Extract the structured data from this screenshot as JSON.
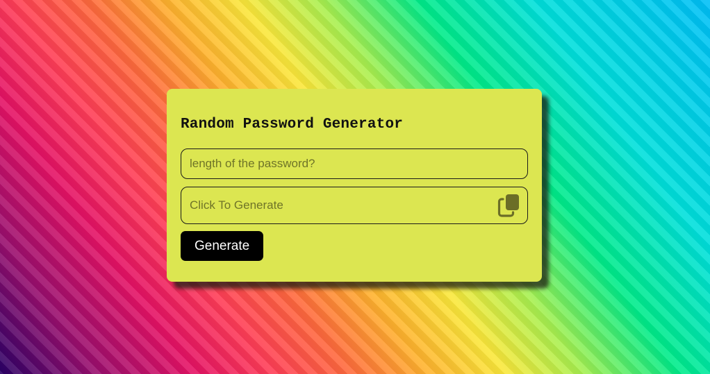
{
  "app": {
    "title": "Random Password Generator"
  },
  "length_input": {
    "placeholder": "length of the password?",
    "value": ""
  },
  "output_input": {
    "placeholder": "Click To Generate",
    "value": ""
  },
  "icons": {
    "copy": "copy-icon"
  },
  "buttons": {
    "generate_label": "Generate"
  },
  "colors": {
    "card_background": "#dce651",
    "button_background": "#000000",
    "button_text": "#ffffff",
    "icon_color": "#6b6e27"
  }
}
